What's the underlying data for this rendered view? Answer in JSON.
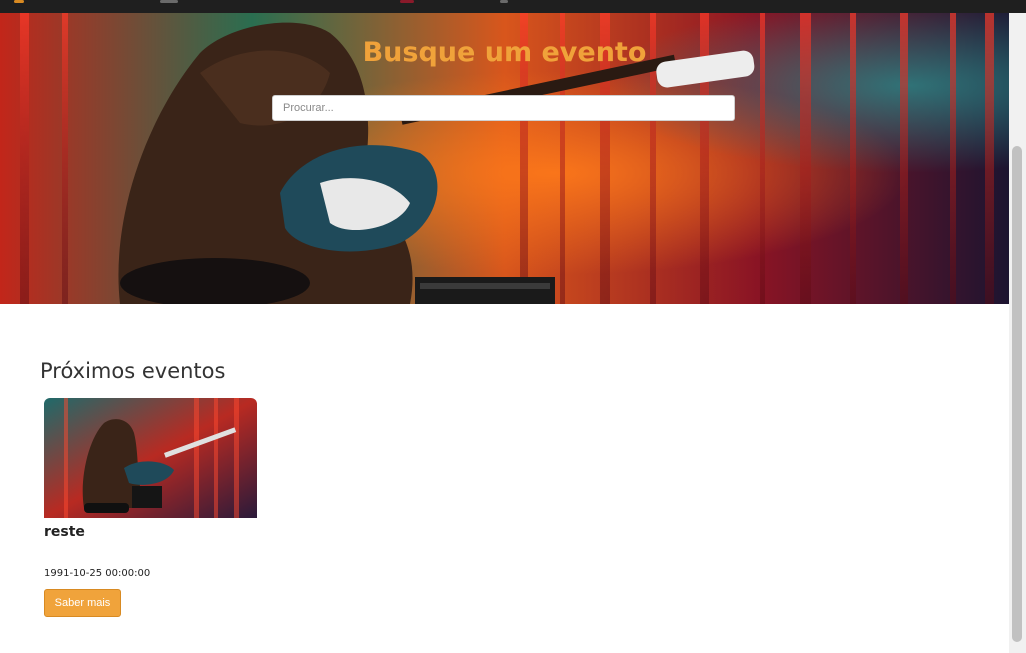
{
  "hero": {
    "title": "Busque um evento",
    "search_placeholder": "Procurar..."
  },
  "events_section": {
    "title": "Próximos eventos",
    "events": [
      {
        "title": "reste",
        "date": "1991-10-25 00:00:00",
        "button_label": "Saber mais"
      }
    ]
  },
  "colors": {
    "accent": "#f0a23a",
    "button": "#f0a33b"
  }
}
